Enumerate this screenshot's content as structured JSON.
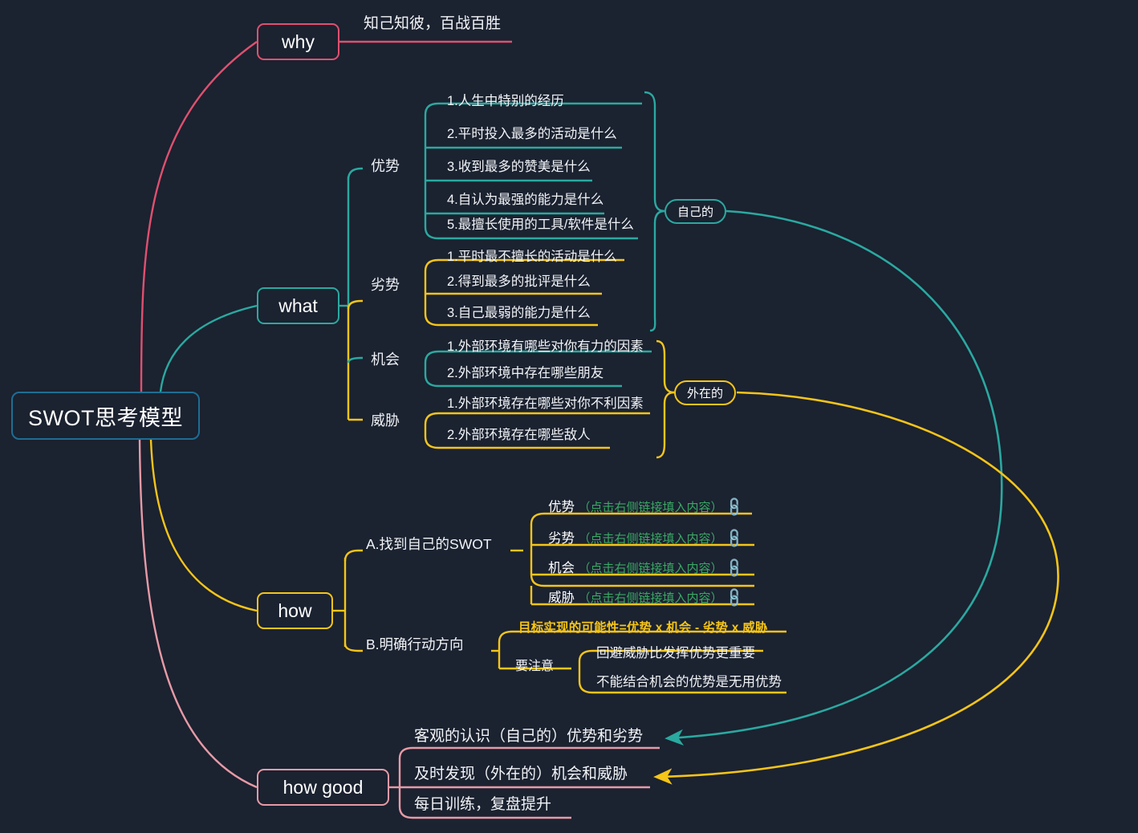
{
  "theme": {
    "background": "#1b2230",
    "root_border": "#1d6e93",
    "why_color": "#e0506f",
    "what_color": "#2aa9a0",
    "how_color": "#f5c518",
    "howgood_color": "#e79aa6",
    "text_color": "#f2f4f7",
    "hint_color": "#3aa864",
    "formula_color": "#f5c518",
    "link_icon_color": "#7fb4e8"
  },
  "root": {
    "label": "SWOT思考模型"
  },
  "branches": {
    "why": {
      "label": "why",
      "children": [
        {
          "label": "知己知彼，百战百胜"
        }
      ]
    },
    "what": {
      "label": "what",
      "groups": [
        {
          "label": "优势",
          "color": "#2aa9a0",
          "items": [
            "1.人生中特别的经历",
            "2.平时投入最多的活动是什么",
            "3.收到最多的赞美是什么",
            "4.自认为最强的能力是什么",
            "5.最擅长使用的工具/软件是什么"
          ]
        },
        {
          "label": "劣势",
          "color": "#f5c518",
          "items": [
            "1.平时最不擅长的活动是什么",
            "2.得到最多的批评是什么",
            "3.自己最弱的能力是什么"
          ]
        },
        {
          "label": "机会",
          "color": "#2aa9a0",
          "items": [
            "1.外部环境有哪些对你有力的因素",
            "2.外部环境中存在哪些朋友"
          ]
        },
        {
          "label": "威胁",
          "color": "#f5c518",
          "items": [
            "1.外部环境存在哪些对你不利因素",
            "2.外部环境存在哪些敌人"
          ]
        }
      ],
      "summaries": [
        {
          "label": "自己的",
          "color": "#2aa9a0"
        },
        {
          "label": "外在的",
          "color": "#f5c518"
        }
      ]
    },
    "how": {
      "label": "how",
      "sections": [
        {
          "label": "A.找到自己的SWOT",
          "items": [
            {
              "title": "优势",
              "hint": "（点击右侧链接填入内容）",
              "icon": "link-icon"
            },
            {
              "title": "劣势",
              "hint": "（点击右侧链接填入内容）",
              "icon": "link-icon"
            },
            {
              "title": "机会",
              "hint": "（点击右侧链接填入内容）",
              "icon": "link-icon"
            },
            {
              "title": "威胁",
              "hint": "（点击右侧链接填入内容）",
              "icon": "link-icon"
            }
          ]
        },
        {
          "label": "B.明确行动方向",
          "formula": "目标实现的可能性=优势 x 机会 - 劣势 x 威胁",
          "note_label": "要注意",
          "notes": [
            "回避威胁比发挥优势更重要",
            "不能结合机会的优势是无用优势"
          ]
        }
      ]
    },
    "how_good": {
      "label": "how good",
      "children": [
        "客观的认识（自己的）优势和劣势",
        "及时发现（外在的）机会和威胁",
        "每日训练，复盘提升"
      ]
    }
  },
  "cross_links": [
    {
      "from": "自己的",
      "to": "客观的认识（自己的）优势和劣势",
      "color": "#2aa9a0"
    },
    {
      "from": "外在的",
      "to": "及时发现（外在的）机会和威胁",
      "color": "#f5c518"
    }
  ]
}
